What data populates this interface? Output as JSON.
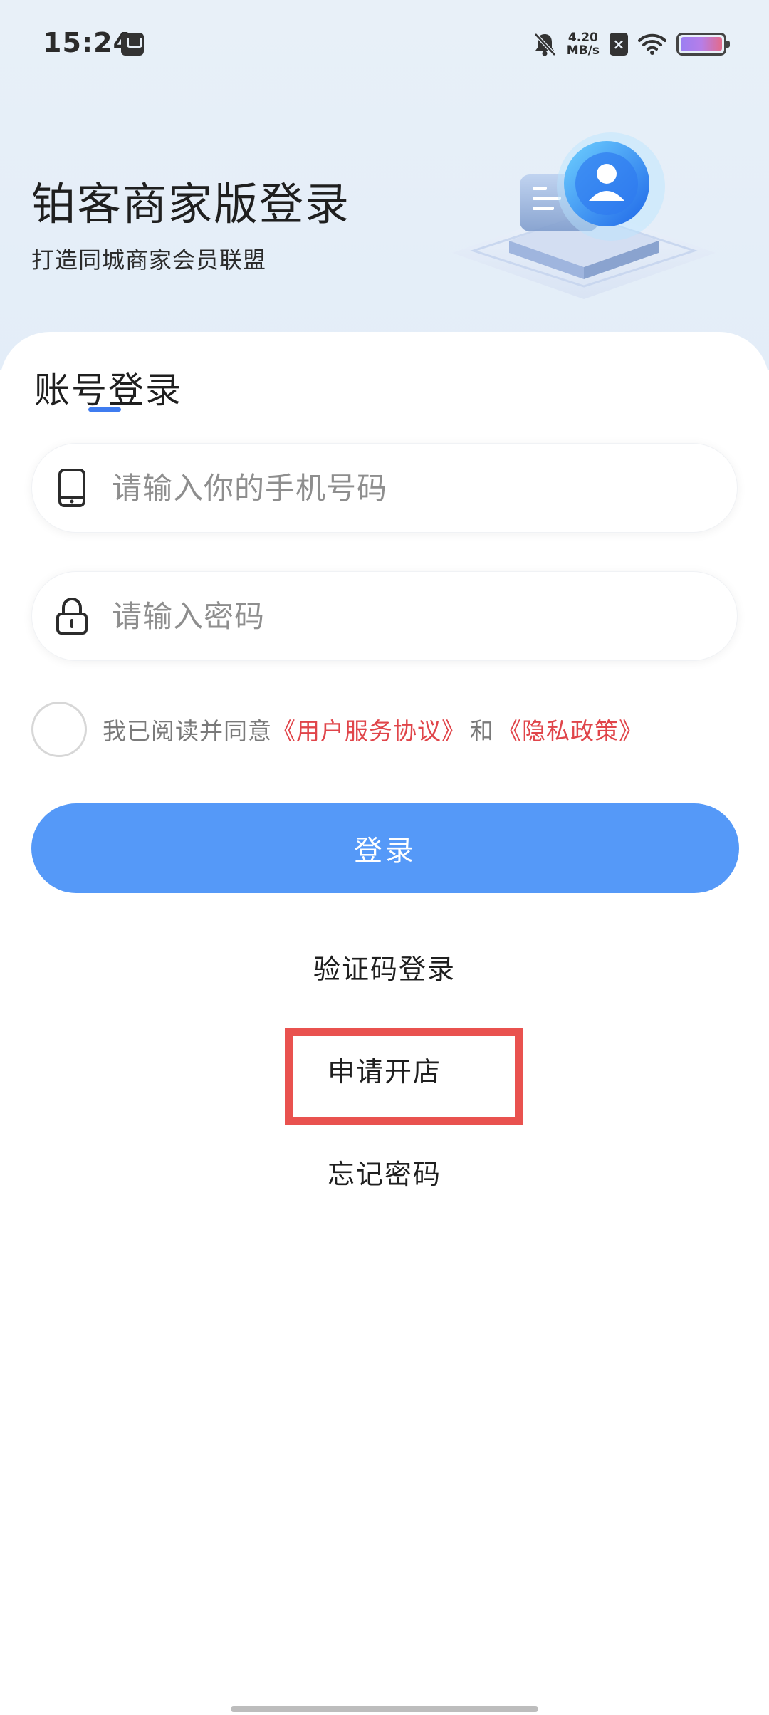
{
  "status_bar": {
    "time": "15:24",
    "net_speed_value": "4.20",
    "net_speed_unit": "MB/s",
    "icons": [
      "calendar-icon",
      "mute-bell-icon",
      "sim-icon",
      "wifi-icon",
      "battery-icon"
    ]
  },
  "header": {
    "title": "铂客商家版登录",
    "subtitle": "打造同城商家会员联盟"
  },
  "login_form": {
    "tab_label": "账号登录",
    "phone_placeholder": "请输入你的手机号码",
    "phone_value": "",
    "password_placeholder": "请输入密码",
    "password_value": "",
    "agreement_prefix": "我已阅读并同意",
    "user_agreement_link": "《用户服务协议》",
    "agreement_and": "和",
    "privacy_link": "《隐私政策》",
    "agreement_checked": false,
    "login_button": "登录"
  },
  "links": {
    "sms_login": "验证码登录",
    "apply_shop": "申请开店",
    "forgot_password": "忘记密码"
  },
  "colors": {
    "accent": "#5599f8",
    "tab_underline": "#3f7cf0",
    "link_red": "#e0454a",
    "highlight_box": "#e9524f"
  }
}
